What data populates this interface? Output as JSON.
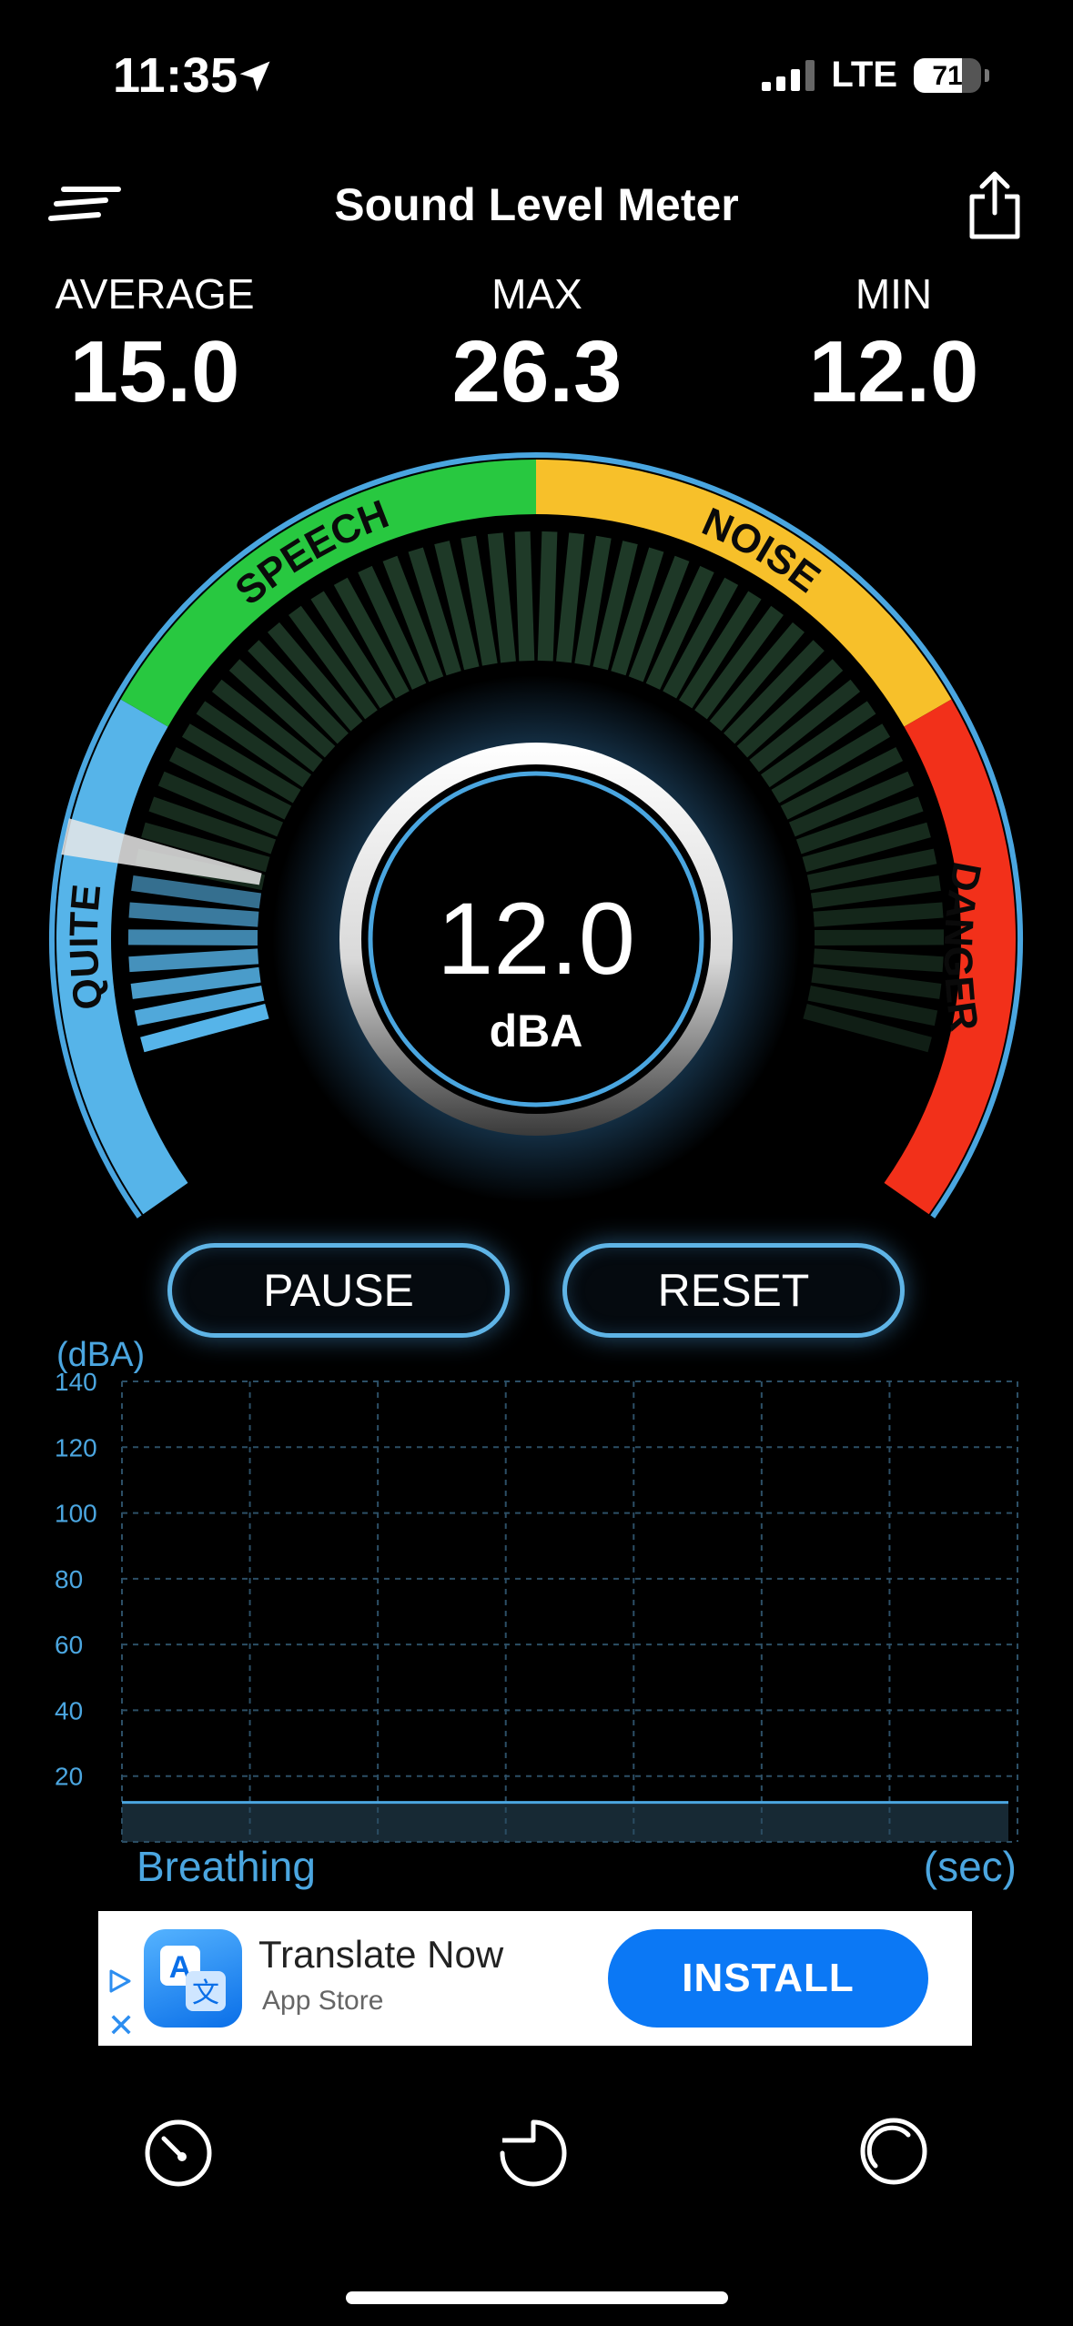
{
  "status_bar": {
    "time": "11:35",
    "network": "LTE",
    "battery": "71",
    "battery_level": 0.71
  },
  "header": {
    "title": "Sound Level Meter",
    "menu_icon": "menu-icon",
    "share_icon": "share-icon"
  },
  "stats": {
    "average_label": "AVERAGE",
    "average_value": "15.0",
    "max_label": "MAX",
    "max_value": "26.3",
    "min_label": "MIN",
    "min_value": "12.0"
  },
  "gauge": {
    "value": "12.0",
    "unit": "dBA",
    "zones": [
      "QUITE",
      "SPEECH",
      "NOISE",
      "DANGER"
    ],
    "zone_colors": {
      "quite": "#56b4e9",
      "speech": "#28c840",
      "noise": "#f7c02a",
      "danger": "#f2301a"
    },
    "ring_color": "#4aa6e0",
    "level_fraction": 0.13
  },
  "controls": {
    "pause_label": "PAUSE",
    "reset_label": "RESET"
  },
  "chart": {
    "unit_label": "(dBA)",
    "left_footer": "Breathing",
    "right_footer": "(sec)",
    "y_ticks": [
      "140",
      "120",
      "100",
      "80",
      "60",
      "40",
      "20"
    ],
    "line_color": "#4ba6e0"
  },
  "chart_data": {
    "type": "area",
    "ylim": [
      0,
      140
    ],
    "y_ticks": [
      20,
      40,
      60,
      80,
      100,
      120,
      140
    ],
    "ylabel": "(dBA)",
    "xlabel": "(sec)",
    "grid": true,
    "series": [
      {
        "values": [
          12,
          12,
          12,
          12,
          12,
          12,
          12,
          12
        ]
      }
    ]
  },
  "ad": {
    "app_name": "Translate Now",
    "source": "App Store",
    "install_label": "INSTALL",
    "close_glyph": "✕"
  },
  "bottom_nav": {
    "items": [
      "meter-icon",
      "history-icon",
      "settings-icon"
    ]
  }
}
